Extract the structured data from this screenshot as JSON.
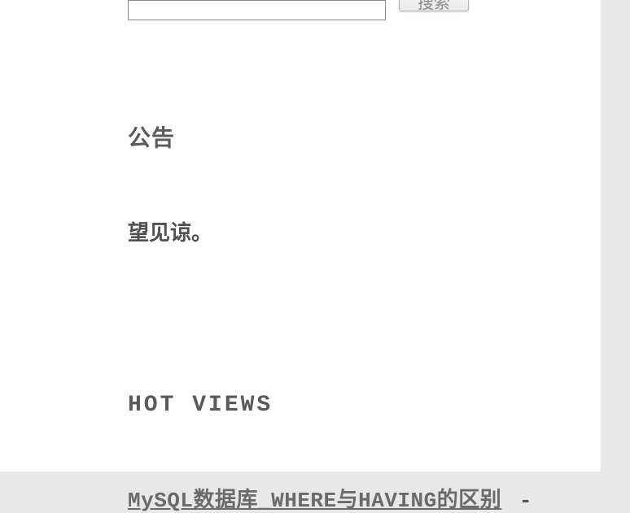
{
  "search": {
    "button_label": "搜索",
    "input_value": ""
  },
  "announcement": {
    "heading": "公告",
    "body": "望见谅。"
  },
  "hot_views": {
    "heading": "HOT VIEWS",
    "items": [
      {
        "link_text": "MySQL数据库_WHERE与HAVING的区别",
        "suffix": " -"
      }
    ]
  }
}
